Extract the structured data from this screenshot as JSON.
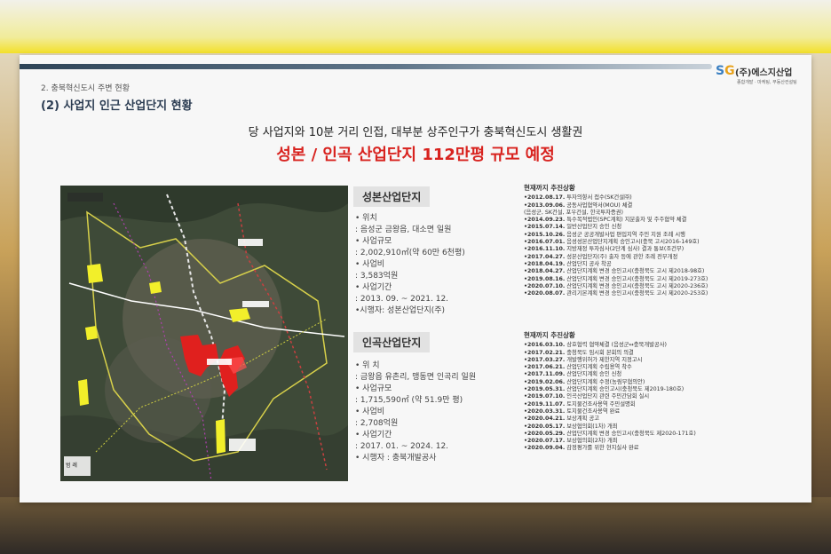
{
  "logo": {
    "mark_s": "S",
    "mark_g": "G",
    "name": "(주)에스지산업",
    "sub": "종합개발 · 마케팅, 부동산컨설팅"
  },
  "section": "2. 충북혁신도시 주변 현황",
  "subtitle": "(2) 사업지 인근 산업단지 현황",
  "headline": "당 사업지와 10분 거리 인접, 대부분 상주인구가 충북혁신도시 생활권",
  "highlight": "성본 / 인곡 산업단지 112만평 규모 예정",
  "map_legend": "범 례",
  "seongbon": {
    "title": "성본산업단지",
    "lines": [
      "• 위치",
      ": 음성군 금왕읍, 대소면 일원",
      "• 사업규모",
      ": 2,002,910㎡(약 60만 6천평)",
      "• 사업비",
      ": 3,583억원",
      "• 사업기간",
      ": 2013. 09. ~ 2021. 12.",
      "•시행자: 성본산업단지(주)"
    ]
  },
  "ingok": {
    "title": "인곡산업단지",
    "lines": [
      "• 위 치",
      ": 금왕읍 유촌리, 맹동면 인곡리 일원",
      "• 사업규모",
      ": 1,715,590㎡ (약 51.9만 평)",
      "• 사업비",
      ": 2,708억원",
      "• 사업기간",
      ": 2017. 01. ~ 2024. 12.",
      "• 시행자 : 충북개발공사"
    ]
  },
  "status1": {
    "heading": "현재까지 추진상황",
    "items": [
      {
        "date": "•2012.08.17.",
        "text": " 투자의향서 접수(SK건설㈜)"
      },
      {
        "date": "•2013.09.06.",
        "text": " 공동사업협약서(MOU) 체결"
      },
      {
        "date": "",
        "text": "(음성군, SK건설, 포우건설, 한국투자증권)"
      },
      {
        "date": "•2014.09.23.",
        "text": " 특수목적법인(SPC계획) 지분출자 및 주주협약 체결"
      },
      {
        "date": "•2015.07.14.",
        "text": " 일반산업단지 승인 신청"
      },
      {
        "date": "•2015.10.26.",
        "text": " 음성군 공공개발사업 편입지역 주민 지원 조례 시행"
      },
      {
        "date": "•2016.07.01.",
        "text": " 음성성본산업단지계획 승인고시(충북 고시2016-149호)"
      },
      {
        "date": "•2016.11.10.",
        "text": " 지방재정 투자심사(2단계 심사) 결과 통보(조건부)"
      },
      {
        "date": "•2017.04.27.",
        "text": " 성본산업단지(주) 출자 등에 관한 조례 전부개정"
      },
      {
        "date": "•2018.04.19.",
        "text": " 산업단지 공사 착공"
      },
      {
        "date": "•2018.04.27.",
        "text": " 산업단지계획 변경 승인고시(충청북도 고시 제2018-98호)"
      },
      {
        "date": "•2019.08.16.",
        "text": " 산업단지계획 변경 승인고시(충청북도 고시 제2019-273호)"
      },
      {
        "date": "•2020.07.10.",
        "text": " 산업단지계획 변경 승인고시(충청북도 고시 제2020-236호)"
      },
      {
        "date": "•2020.08.07.",
        "text": " 관리기본계획 변경 승인고시(충청북도 고시 제2020-253호)"
      }
    ]
  },
  "status2": {
    "heading": "현재까지 추진상황",
    "items": [
      {
        "date": "•2016.03.10.",
        "text": " 상호협력 협약체결 (음성군↔충북개발공사)"
      },
      {
        "date": "•2017.02.21.",
        "text": " 충청북도 임시회 본회의 의결"
      },
      {
        "date": "•2017.03.27.",
        "text": " 개발행위허가 제한지역 지정고시"
      },
      {
        "date": "•2017.06.21.",
        "text": " 산업단지계획 수립용역 착수"
      },
      {
        "date": "•2017.11.09.",
        "text": " 산업단지계획 승인 신청"
      },
      {
        "date": "•2019.02.06.",
        "text": " 산업단지계획 수정(농림부협의안)"
      },
      {
        "date": "•2019.05.31.",
        "text": " 산업단지계획 승인고시(충청북도 제2019-180호)"
      },
      {
        "date": "•2019.07.10.",
        "text": " 인곡산업단지 관련 주민간담회 실시"
      },
      {
        "date": "•2019.11.07.",
        "text": " 토지물건조사용역 주민설명회"
      },
      {
        "date": "•2020.03.31.",
        "text": " 토지물건조사용역 완료"
      },
      {
        "date": "•2020.04.21.",
        "text": " 보상계획 공고"
      },
      {
        "date": "•2020.05.17.",
        "text": " 보상협의회(1차) 개최"
      },
      {
        "date": "•2020.05.29.",
        "text": " 산업단지계획 변경 승인고시(충청북도 제2020-171호)"
      },
      {
        "date": "•2020.07.17.",
        "text": " 보상협의회(2차) 개최"
      },
      {
        "date": "•2020.09.04.",
        "text": " 감정평가를 위한 현지실사 완료"
      }
    ]
  }
}
